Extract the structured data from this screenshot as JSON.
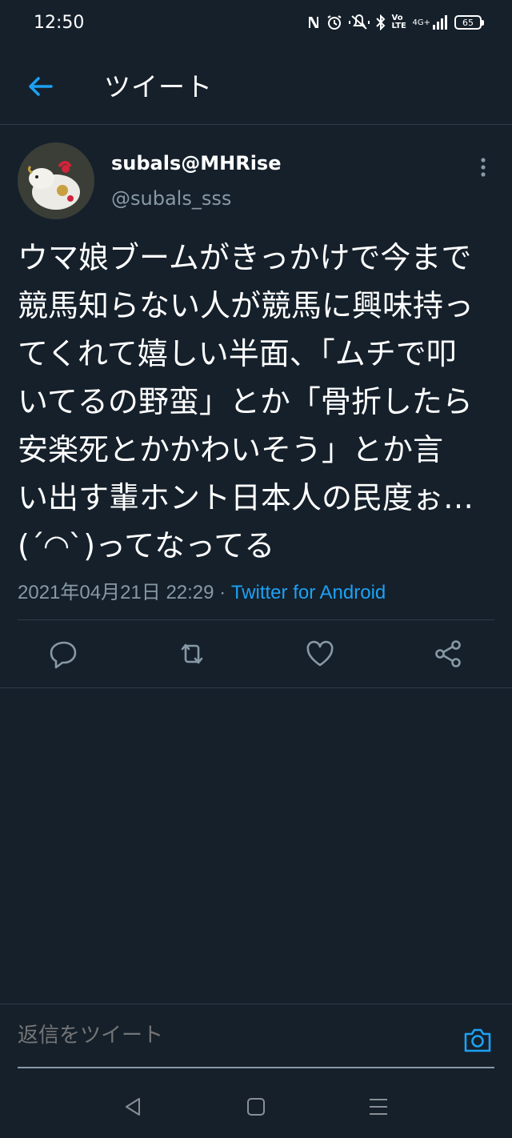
{
  "status_bar": {
    "time": "12:50",
    "network": "4G+",
    "volte": "Vo LTE",
    "battery": "65",
    "icons": [
      "nfc-icon",
      "alarm-icon",
      "vibrate-icon",
      "bluetooth-icon",
      "volte-icon",
      "signal-icon",
      "battery-icon"
    ]
  },
  "header": {
    "title": "ツイート",
    "back_icon": "arrow-left-icon"
  },
  "tweet": {
    "display_name": "subals@MHRise",
    "handle": "@subals_sss",
    "text": "ウマ娘ブームがきっかけで今まで\n競馬知らない人が競馬に興味持っ\nてくれて嬉しい半面、「ムチで叩\nいてるの野蛮」とか「骨折したら\n安楽死とかかわいそう」とか言\nい出す輩ホント日本人の民度ぉ…\n(´◜◝`)ってなってる",
    "datetime": "2021年04月21日 22:29",
    "separator": " · ",
    "client": "Twitter for Android"
  },
  "actions": {
    "reply_icon": "reply-icon",
    "retweet_icon": "retweet-icon",
    "like_icon": "heart-icon",
    "share_icon": "share-icon"
  },
  "reply_bar": {
    "placeholder": "返信をツイート",
    "camera_icon": "camera-icon"
  },
  "colors": {
    "background": "#15202b",
    "accent": "#1da1f2",
    "secondary_text": "#8899a6",
    "divider": "#2f3b47"
  }
}
